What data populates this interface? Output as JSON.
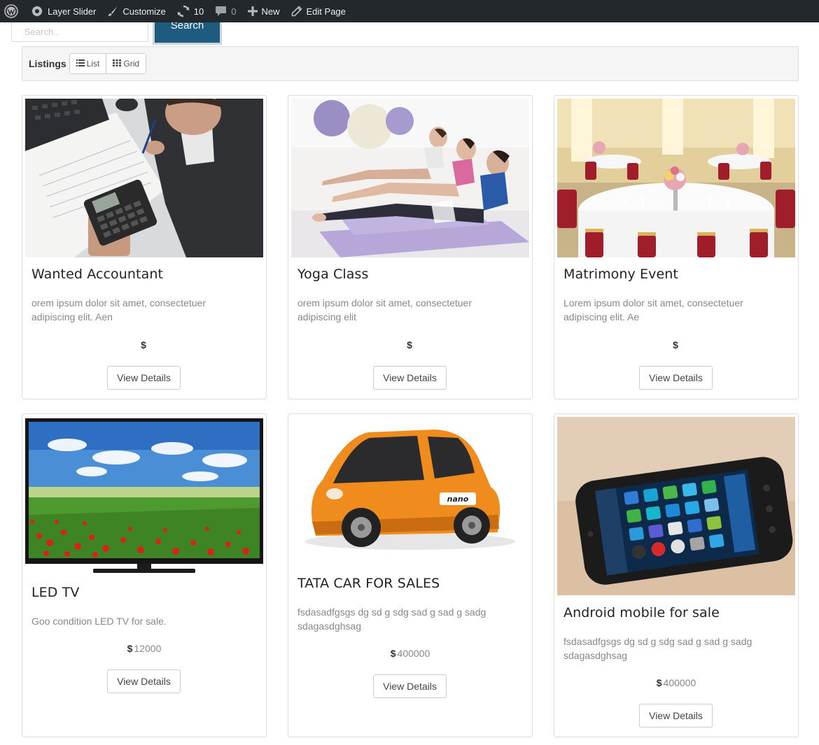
{
  "admin_bar": {
    "site_name": "Layer Slider",
    "customize": "Customize",
    "updates_count": "10",
    "comments_count": "0",
    "new": "New",
    "edit_page": "Edit Page"
  },
  "search": {
    "placeholder": "Search..",
    "button_label": "Search"
  },
  "listings": {
    "title": "Listings",
    "list_label": "List",
    "grid_label": "Grid"
  },
  "currency_symbol": "$",
  "details_label": "View Details",
  "cards": [
    {
      "title": "Wanted Accountant",
      "description": "orem ipsum dolor sit amet, consectetuer adipiscing elit. Aen",
      "price": ""
    },
    {
      "title": "Yoga Class",
      "description": "orem ipsum dolor sit amet, consectetuer adipiscing elit",
      "price": ""
    },
    {
      "title": "Matrimony Event",
      "description": "Lorem ipsum dolor sit amet, consectetuer adipiscing elit. Ae",
      "price": ""
    },
    {
      "title": "LED TV",
      "description": "Goo condition LED TV for sale.",
      "price": "12000"
    },
    {
      "title": "TATA CAR FOR SALES",
      "description": "fsdasadfgsgs dg sd g sdg sad g sad g sadg sdagasdghsag",
      "price": "400000"
    },
    {
      "title": "Android mobile for sale",
      "description": "fsdasadfgsgs dg sd g sdg sad g sad g sadg sdagasdghsag",
      "price": "400000"
    }
  ],
  "colors": {
    "admin_bar_bg": "#23282d",
    "search_button_bg": "#1f5b7e",
    "listbar_bg": "#f5f5f5"
  },
  "icons": [
    "wordpress-icon",
    "brush-icon",
    "updates-icon",
    "comment-icon",
    "plus-icon",
    "pencil-icon",
    "list-icon",
    "grid-icon"
  ]
}
